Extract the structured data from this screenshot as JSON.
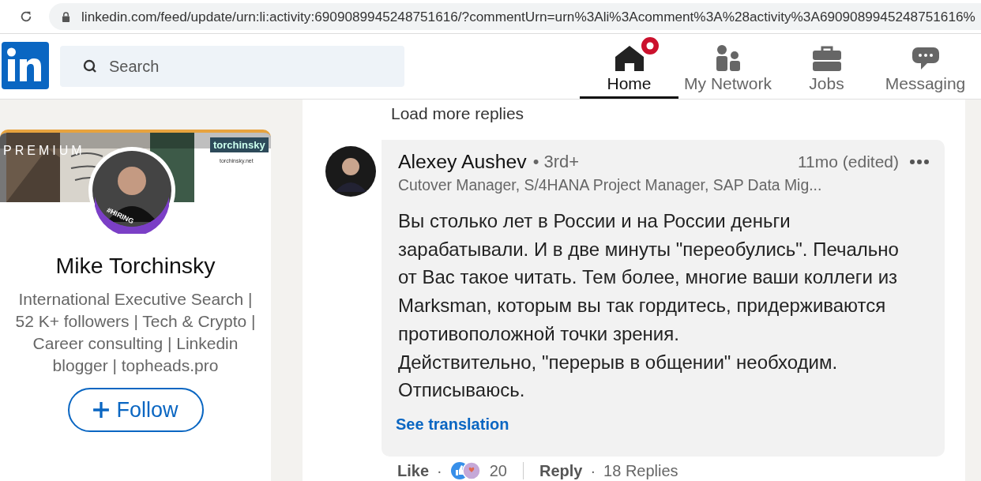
{
  "browser": {
    "url": "linkedin.com/feed/update/urn:li:activity:6909089945248751616/?commentUrn=urn%3Ali%3Acomment%3A%28activity%3A6909089945248751616%"
  },
  "nav": {
    "search": {
      "placeholder": "Search"
    },
    "items": [
      {
        "label": "Home",
        "kind": "home",
        "selected": true,
        "notification": true
      },
      {
        "label": "My Network",
        "kind": "network",
        "selected": false,
        "notification": false
      },
      {
        "label": "Jobs",
        "kind": "jobs",
        "selected": false,
        "notification": false
      },
      {
        "label": "Messaging",
        "kind": "messaging",
        "selected": false,
        "notification": false
      }
    ]
  },
  "profile": {
    "premium_label": "PREMIUM",
    "banner_brand": "torchinsky",
    "banner_site": "torchinsky.net",
    "badge": "#HIRING",
    "name": "Mike Torchinsky",
    "headline": "International Executive Search | 52 K+ followers | Tech & Crypto | Career consulting | Linkedin blogger | topheads.pro",
    "follow_label": "Follow"
  },
  "thread": {
    "load_more": "Load more replies",
    "comment": {
      "author": "Alexey Aushev",
      "degree": "• 3rd+",
      "time": "11mo (edited)",
      "subtitle": "Cutover Manager, S/4HANA Project Manager, SAP Data Mig...",
      "body": "Вы столько лет в России и на России деньги зарабатывали. И в две минуты \"переобулись\". Печально от Вас такое читать. Тем более, многие ваши коллеги из Marksman, которым вы так гордитесь, придерживаются противоположной точки зрения.\nДействительно, \"перерыв в общении\" необходим. Отписываюсь.",
      "see_translation": "See translation",
      "actions": {
        "like": "Like",
        "separator_1": "·",
        "reaction_count": "20",
        "reply": "Reply",
        "separator_2": "·",
        "replies": "18 Replies"
      }
    }
  }
}
